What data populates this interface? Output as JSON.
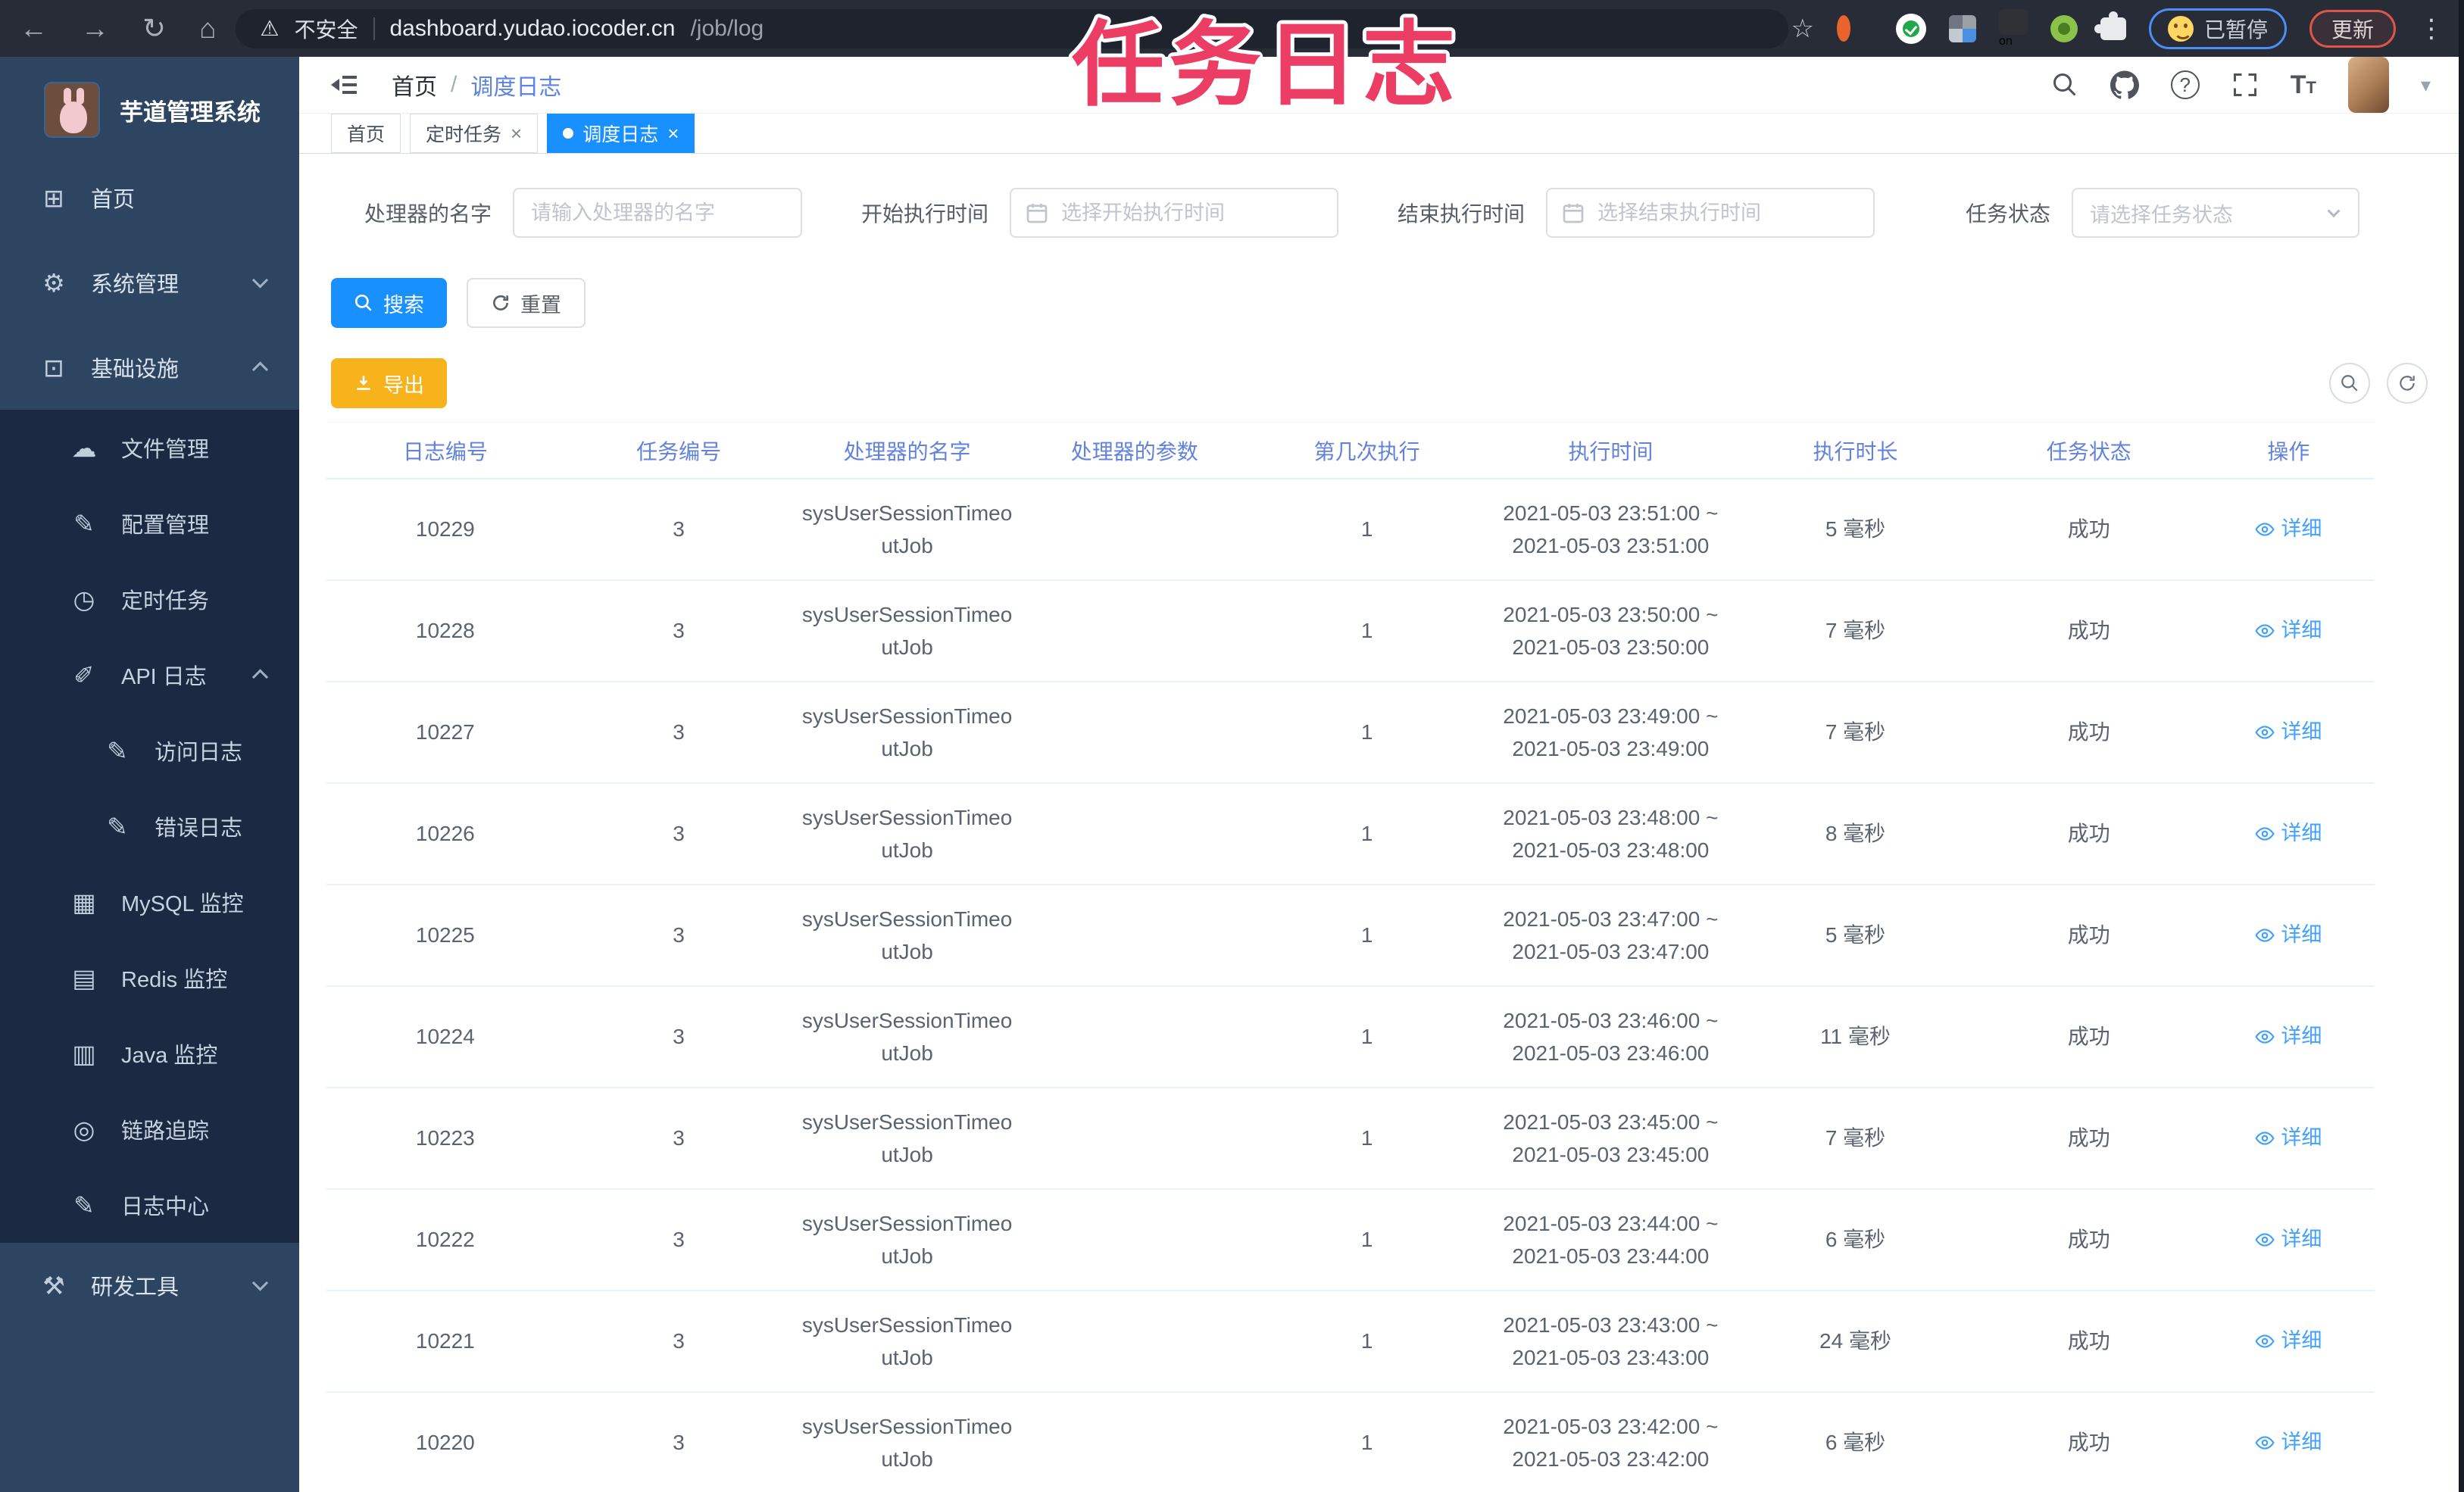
{
  "glyphs": {
    "back": "←",
    "forward": "→",
    "reload": "↻",
    "home": "⌂",
    "warning": "⚠",
    "star": "☆",
    "kebab": "⋮",
    "dashboard": "⊞",
    "gear": "⚙",
    "infra": "⊡",
    "cloud": "☁",
    "edit": "✎",
    "timer": "◷",
    "api": "✐",
    "mysql": "▦",
    "redis": "▤",
    "java": "▥",
    "trace": "◎",
    "logcenter": "✎",
    "tools": "⚒",
    "sep": "/",
    "close": "×",
    "caret": "▾",
    "question": "?",
    "font_t": "T",
    "ext_on": "on"
  },
  "browser": {
    "security": "不安全",
    "url_host": "dashboard.yudao.iocoder.cn",
    "url_path": "/job/log",
    "paused": "已暂停",
    "update": "更新"
  },
  "overlay": {
    "title": "任务日志",
    "color": "#ec3e64"
  },
  "sidebar": {
    "app_title": "芋道管理系统",
    "items": [
      {
        "label": "首页"
      },
      {
        "label": "系统管理"
      },
      {
        "label": "基础设施"
      },
      {
        "label": "文件管理"
      },
      {
        "label": "配置管理"
      },
      {
        "label": "定时任务"
      },
      {
        "label": "API 日志"
      },
      {
        "label": "访问日志"
      },
      {
        "label": "错误日志"
      },
      {
        "label": "MySQL 监控"
      },
      {
        "label": "Redis 监控"
      },
      {
        "label": "Java 监控"
      },
      {
        "label": "链路追踪"
      },
      {
        "label": "日志中心"
      },
      {
        "label": "研发工具"
      }
    ]
  },
  "breadcrumb": {
    "items": [
      "首页",
      "调度日志"
    ]
  },
  "tabs": {
    "items": [
      {
        "label": "首页"
      },
      {
        "label": "定时任务"
      },
      {
        "label": "调度日志"
      }
    ]
  },
  "filters": {
    "handler_label": "处理器的名字",
    "handler_placeholder": "请输入处理器的名字",
    "start_label": "开始执行时间",
    "start_placeholder": "选择开始执行时间",
    "end_label": "结束执行时间",
    "end_placeholder": "选择结束执行时间",
    "status_label": "任务状态",
    "status_placeholder": "请选择任务状态"
  },
  "actions": {
    "search": "搜索",
    "reset": "重置",
    "export": "导出"
  },
  "table": {
    "columns": [
      "日志编号",
      "任务编号",
      "处理器的名字",
      "处理器的参数",
      "第几次执行",
      "执行时间",
      "执行时长",
      "任务状态",
      "操作"
    ],
    "detail": "详细",
    "rows": [
      {
        "id": "10229",
        "job_id": "3",
        "handler": "sysUserSessionTimeoutJob",
        "param": "",
        "run_index": "1",
        "time_start": "2021-05-03 23:51:00 ~",
        "time_end": "2021-05-03 23:51:00",
        "duration": "5 毫秒",
        "status": "成功"
      },
      {
        "id": "10228",
        "job_id": "3",
        "handler": "sysUserSessionTimeoutJob",
        "param": "",
        "run_index": "1",
        "time_start": "2021-05-03 23:50:00 ~",
        "time_end": "2021-05-03 23:50:00",
        "duration": "7 毫秒",
        "status": "成功"
      },
      {
        "id": "10227",
        "job_id": "3",
        "handler": "sysUserSessionTimeoutJob",
        "param": "",
        "run_index": "1",
        "time_start": "2021-05-03 23:49:00 ~",
        "time_end": "2021-05-03 23:49:00",
        "duration": "7 毫秒",
        "status": "成功"
      },
      {
        "id": "10226",
        "job_id": "3",
        "handler": "sysUserSessionTimeoutJob",
        "param": "",
        "run_index": "1",
        "time_start": "2021-05-03 23:48:00 ~",
        "time_end": "2021-05-03 23:48:00",
        "duration": "8 毫秒",
        "status": "成功"
      },
      {
        "id": "10225",
        "job_id": "3",
        "handler": "sysUserSessionTimeoutJob",
        "param": "",
        "run_index": "1",
        "time_start": "2021-05-03 23:47:00 ~",
        "time_end": "2021-05-03 23:47:00",
        "duration": "5 毫秒",
        "status": "成功"
      },
      {
        "id": "10224",
        "job_id": "3",
        "handler": "sysUserSessionTimeoutJob",
        "param": "",
        "run_index": "1",
        "time_start": "2021-05-03 23:46:00 ~",
        "time_end": "2021-05-03 23:46:00",
        "duration": "11 毫秒",
        "status": "成功"
      },
      {
        "id": "10223",
        "job_id": "3",
        "handler": "sysUserSessionTimeoutJob",
        "param": "",
        "run_index": "1",
        "time_start": "2021-05-03 23:45:00 ~",
        "time_end": "2021-05-03 23:45:00",
        "duration": "7 毫秒",
        "status": "成功"
      },
      {
        "id": "10222",
        "job_id": "3",
        "handler": "sysUserSessionTimeoutJob",
        "param": "",
        "run_index": "1",
        "time_start": "2021-05-03 23:44:00 ~",
        "time_end": "2021-05-03 23:44:00",
        "duration": "6 毫秒",
        "status": "成功"
      },
      {
        "id": "10221",
        "job_id": "3",
        "handler": "sysUserSessionTimeoutJob",
        "param": "",
        "run_index": "1",
        "time_start": "2021-05-03 23:43:00 ~",
        "time_end": "2021-05-03 23:43:00",
        "duration": "24 毫秒",
        "status": "成功"
      },
      {
        "id": "10220",
        "job_id": "3",
        "handler": "sysUserSessionTimeoutJob",
        "param": "",
        "run_index": "1",
        "time_start": "2021-05-03 23:42:00 ~",
        "time_end": "2021-05-03 23:42:00",
        "duration": "6 毫秒",
        "status": "成功"
      }
    ]
  }
}
